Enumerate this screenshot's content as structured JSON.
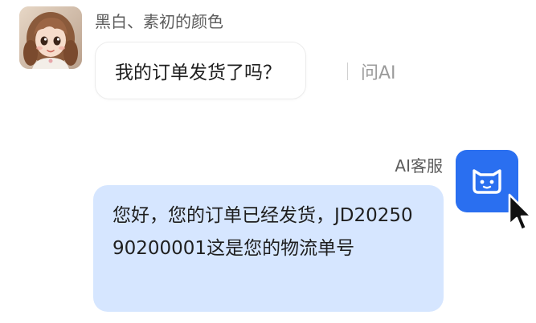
{
  "incoming": {
    "sender_name": "黑白、素初的颜色",
    "message": "我的订单发货了吗？",
    "ask_ai_label": "问AI",
    "avatar_icon": "cartoon-girl-avatar"
  },
  "outgoing": {
    "sender_name": "AI客服",
    "message": "您好，您的订单已经发货，JD2025090200001这是您的物流单号",
    "avatar_icon": "cat-face-icon",
    "avatar_color": "#2a6ff0",
    "bubble_color": "#d6e6ff"
  },
  "cursor_icon": "mouse-pointer-icon"
}
